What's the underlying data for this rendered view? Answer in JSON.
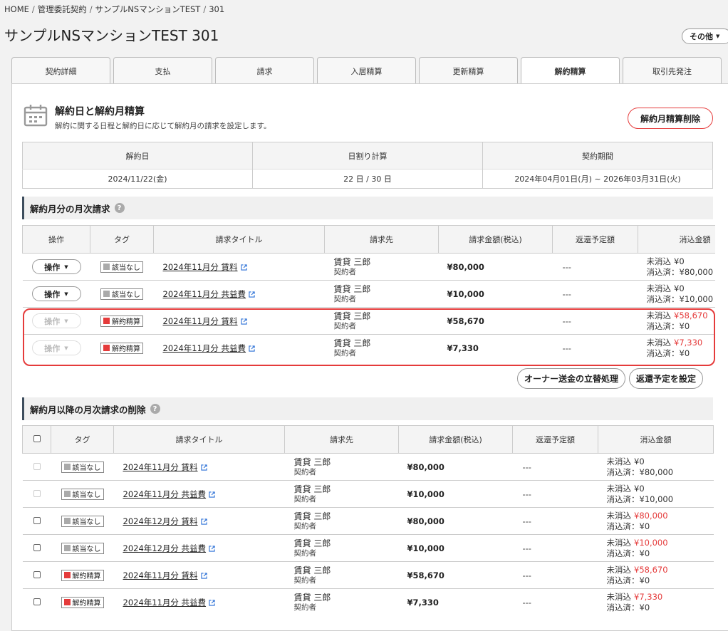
{
  "breadcrumb": {
    "items": [
      "HOME",
      "管理委託契約",
      "サンプルNSマンションTEST",
      "301"
    ]
  },
  "page_title": "サンプルNSマンションTEST 301",
  "other_button": "その他",
  "tabs": [
    {
      "label": "契約詳細",
      "active": false
    },
    {
      "label": "支払",
      "active": false
    },
    {
      "label": "請求",
      "active": false
    },
    {
      "label": "入居精算",
      "active": false
    },
    {
      "label": "更新精算",
      "active": false
    },
    {
      "label": "解約精算",
      "active": true
    },
    {
      "label": "取引先発注",
      "active": false
    }
  ],
  "section": {
    "title": "解約日と解約月精算",
    "description": "解約に関する日程と解約日に応じて解約月の請求を設定します。",
    "icon": "calendar-icon",
    "delete_button": "解約月精算削除"
  },
  "summary": {
    "headers": [
      "解約日",
      "日割り計算",
      "契約期間"
    ],
    "values": [
      "2024/11/22(金)",
      "22 日 / 30 日",
      "2024年04月01日(月) ~ 2026年03月31日(火)"
    ]
  },
  "monthly": {
    "heading": "解約月分の月次請求",
    "columns": [
      "操作",
      "タグ",
      "請求タイトル",
      "請求先",
      "請求金額(税込)",
      "返還予定額",
      "消込金額"
    ],
    "rows": [
      {
        "op": "操作",
        "op_enabled": true,
        "tag": "該当なし",
        "tag_color": "#aaaaaa",
        "title": "2024年11月分 賃料",
        "payer": "賃貸 三郎",
        "role": "契約者",
        "amount": "¥80,000",
        "refund": "---",
        "unreconciled_label": "未消込",
        "unreconciled": "¥0",
        "unreconciled_red": false,
        "reconciled_label": "消込済",
        "reconciled": "¥80,000"
      },
      {
        "op": "操作",
        "op_enabled": true,
        "tag": "該当なし",
        "tag_color": "#aaaaaa",
        "title": "2024年11月分 共益費",
        "payer": "賃貸 三郎",
        "role": "契約者",
        "amount": "¥10,000",
        "refund": "---",
        "unreconciled_label": "未消込",
        "unreconciled": "¥0",
        "unreconciled_red": false,
        "reconciled_label": "消込済",
        "reconciled": "¥10,000"
      },
      {
        "op": "操作",
        "op_enabled": false,
        "tag": "解約精算",
        "tag_color": "#e53b3b",
        "title": "2024年11月分 賃料",
        "payer": "賃貸 三郎",
        "role": "契約者",
        "amount": "¥58,670",
        "refund": "---",
        "unreconciled_label": "未消込",
        "unreconciled": "¥58,670",
        "unreconciled_red": true,
        "reconciled_label": "消込済",
        "reconciled": "¥0"
      },
      {
        "op": "操作",
        "op_enabled": false,
        "tag": "解約精算",
        "tag_color": "#e53b3b",
        "title": "2024年11月分 共益費",
        "payer": "賃貸 三郎",
        "role": "契約者",
        "amount": "¥7,330",
        "refund": "---",
        "unreconciled_label": "未消込",
        "unreconciled": "¥7,330",
        "unreconciled_red": true,
        "reconciled_label": "消込済",
        "reconciled": "¥0"
      }
    ],
    "buttons": [
      "オーナー送金の立替処理",
      "返還予定を設定"
    ]
  },
  "deletion": {
    "heading": "解約月以降の月次請求の削除",
    "columns": [
      "タグ",
      "請求タイトル",
      "請求先",
      "請求金額(税込)",
      "返還予定額",
      "消込金額"
    ],
    "rows": [
      {
        "checkbox_enabled": false,
        "tag": "該当なし",
        "tag_color": "#aaaaaa",
        "title": "2024年11月分 賃料",
        "payer": "賃貸 三郎",
        "role": "契約者",
        "amount": "¥80,000",
        "refund": "---",
        "unreconciled_label": "未消込",
        "unreconciled": "¥0",
        "unreconciled_red": false,
        "reconciled_label": "消込済",
        "reconciled": "¥80,000"
      },
      {
        "checkbox_enabled": false,
        "tag": "該当なし",
        "tag_color": "#aaaaaa",
        "title": "2024年11月分 共益費",
        "payer": "賃貸 三郎",
        "role": "契約者",
        "amount": "¥10,000",
        "refund": "---",
        "unreconciled_label": "未消込",
        "unreconciled": "¥0",
        "unreconciled_red": false,
        "reconciled_label": "消込済",
        "reconciled": "¥10,000"
      },
      {
        "checkbox_enabled": true,
        "tag": "該当なし",
        "tag_color": "#aaaaaa",
        "title": "2024年12月分 賃料",
        "payer": "賃貸 三郎",
        "role": "契約者",
        "amount": "¥80,000",
        "refund": "---",
        "unreconciled_label": "未消込",
        "unreconciled": "¥80,000",
        "unreconciled_red": true,
        "reconciled_label": "消込済",
        "reconciled": "¥0"
      },
      {
        "checkbox_enabled": true,
        "tag": "該当なし",
        "tag_color": "#aaaaaa",
        "title": "2024年12月分 共益費",
        "payer": "賃貸 三郎",
        "role": "契約者",
        "amount": "¥10,000",
        "refund": "---",
        "unreconciled_label": "未消込",
        "unreconciled": "¥10,000",
        "unreconciled_red": true,
        "reconciled_label": "消込済",
        "reconciled": "¥0"
      },
      {
        "checkbox_enabled": true,
        "tag": "解約精算",
        "tag_color": "#e53b3b",
        "title": "2024年11月分 賃料",
        "payer": "賃貸 三郎",
        "role": "契約者",
        "amount": "¥58,670",
        "refund": "---",
        "unreconciled_label": "未消込",
        "unreconciled": "¥58,670",
        "unreconciled_red": true,
        "reconciled_label": "消込済",
        "reconciled": "¥0"
      },
      {
        "checkbox_enabled": true,
        "tag": "解約精算",
        "tag_color": "#e53b3b",
        "title": "2024年11月分 共益費",
        "payer": "賃貸 三郎",
        "role": "契約者",
        "amount": "¥7,330",
        "refund": "---",
        "unreconciled_label": "未消込",
        "unreconciled": "¥7,330",
        "unreconciled_red": true,
        "reconciled_label": "消込済",
        "reconciled": "¥0"
      }
    ]
  },
  "colors": {
    "accent_red": "#e53b3b",
    "neutral_tag": "#aaaaaa",
    "heading_bar": "#3d4d5d"
  }
}
